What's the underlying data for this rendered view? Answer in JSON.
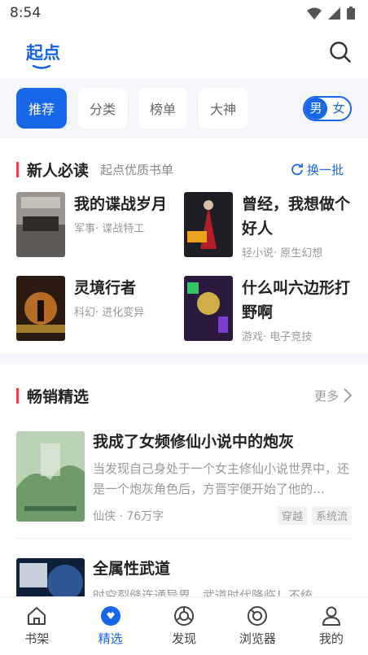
{
  "status_bar": {
    "time": "8:54",
    "icons": [
      "wifi-icon",
      "signal-icon",
      "battery-icon"
    ]
  },
  "header": {
    "brand": "起点",
    "search_icon": "search-icon"
  },
  "filters": {
    "chips": [
      {
        "label": "推荐",
        "active": true
      },
      {
        "label": "分类",
        "active": false
      },
      {
        "label": "榜单",
        "active": false
      },
      {
        "label": "大神",
        "active": false
      }
    ],
    "gender": {
      "male": "男",
      "female": "女",
      "selected": "男"
    }
  },
  "newbie": {
    "title": "新人必读",
    "subtitle": "起点优质书单",
    "refresh_label": "换一批",
    "books": [
      {
        "name": "我的谍战岁月",
        "tags": "军事· 谍战特工"
      },
      {
        "name": "曾经，我想做个好人",
        "tags": "轻小说· 原生幻想"
      },
      {
        "name": "灵境行者",
        "tags": "科幻· 进化变异"
      },
      {
        "name": "什么叫六边形打野啊",
        "tags": "游戏· 电子竞技"
      }
    ]
  },
  "bestseller": {
    "title": "畅销精选",
    "more_label": "更多",
    "books": [
      {
        "name": "我成了女频修仙小说中的炮灰",
        "desc": "当发现自己身处于一个女主修仙小说世界中，还是一个炮灰角色后，方晋宇便开始了他的…",
        "category": "仙侠 · 76万字",
        "badges": [
          "穿越",
          "系统流"
        ]
      },
      {
        "name": "全属性武道",
        "desc": "时空裂缝连通异界，武道时代降临！不统…",
        "category": "",
        "badges": []
      }
    ]
  },
  "colors": {
    "accent": "#1767e8",
    "section_marker": "#e8414e"
  },
  "tabbar": [
    {
      "label": "书架",
      "icon": "bookshelf-icon",
      "active": false
    },
    {
      "label": "精选",
      "icon": "featured-icon",
      "active": true
    },
    {
      "label": "发现",
      "icon": "discover-icon",
      "active": false
    },
    {
      "label": "浏览器",
      "icon": "browser-icon",
      "active": false
    },
    {
      "label": "我的",
      "icon": "profile-icon",
      "active": false
    }
  ]
}
